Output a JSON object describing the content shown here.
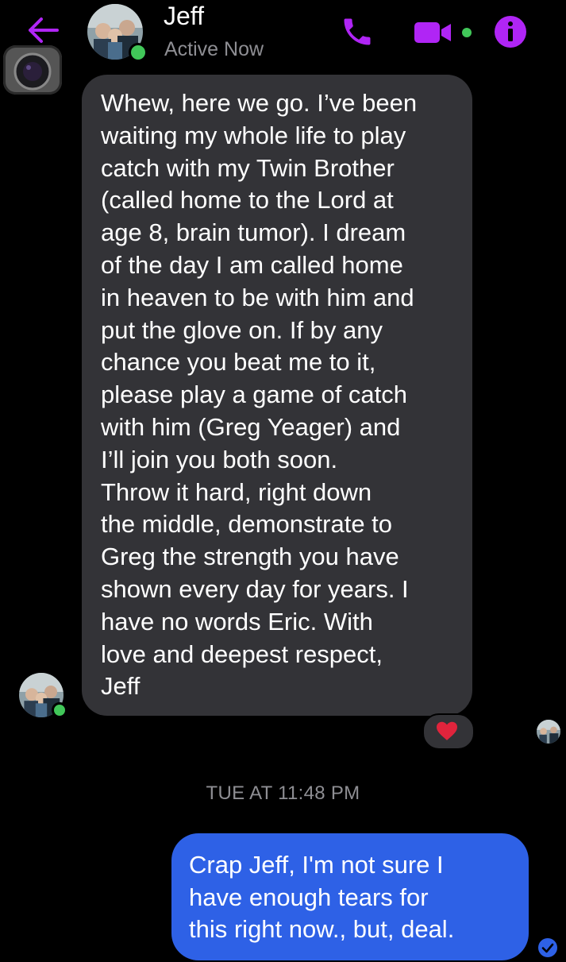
{
  "header": {
    "contact_name": "Jeff",
    "status": "Active Now",
    "icons": [
      "back-arrow-icon",
      "phone-icon",
      "video-camera-icon",
      "info-icon"
    ],
    "accent_color": "#b025f5",
    "online_color": "#41c759"
  },
  "incoming": {
    "text": "Whew, here we go.  I’ve been\nwaiting my whole life to play\ncatch with my Twin Brother\n(called home to the Lord at\nage 8, brain tumor).  I dream\nof the day I am called home\nin heaven to be with him and\nput the glove on.  If by any\nchance you beat me to it,\nplease play a game of catch\nwith him (Greg Yeager) and\nI’ll join you both soon.\nThrow it hard, right down\nthe middle, demonstrate to\nGreg the strength you have\nshown every day for years.  I\nhave no words Eric.  With\nlove and deepest respect,\nJeff",
    "reaction": "heart",
    "bubble_color": "#333337"
  },
  "timestamp": "TUE AT 11:48 PM",
  "outgoing": {
    "text": "Crap Jeff, I'm not sure I\nhave enough tears for\nthis right now., but, deal.",
    "bubble_color": "#2e61e6"
  }
}
